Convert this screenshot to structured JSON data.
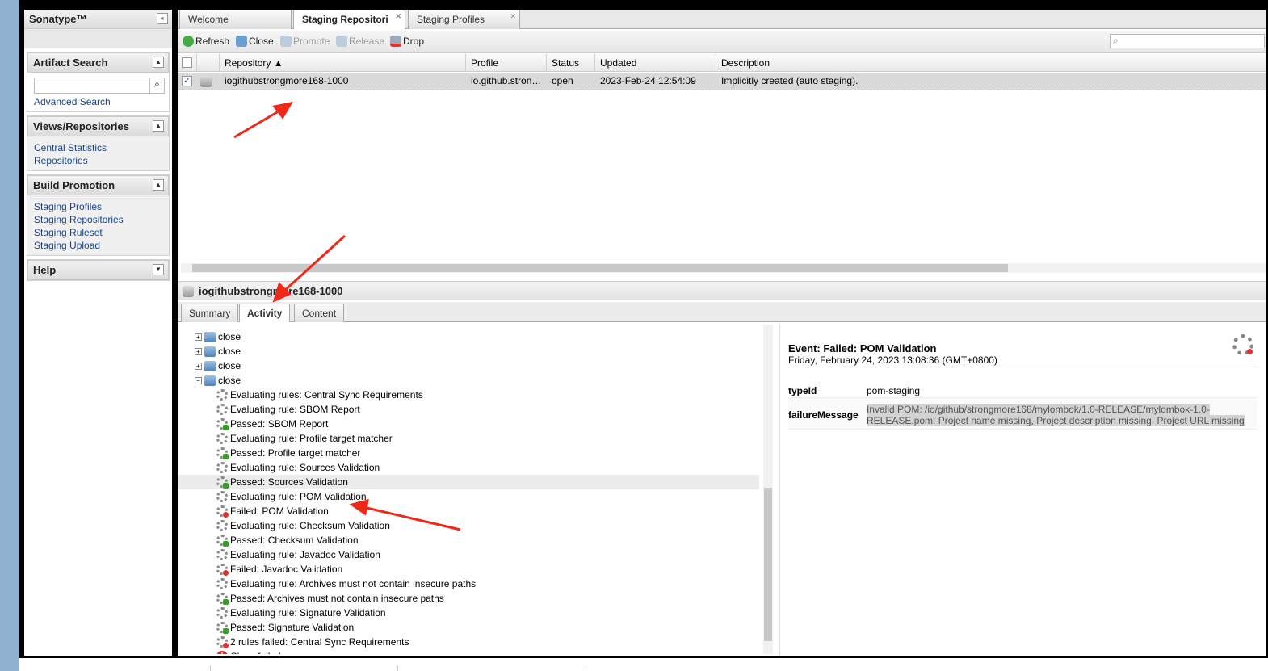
{
  "sidebar": {
    "title": "Sonatype™",
    "artifact_search": {
      "title": "Artifact Search",
      "placeholder": "",
      "advanced": "Advanced Search"
    },
    "views": {
      "title": "Views/Repositories",
      "items": [
        "Central Statistics",
        "Repositories"
      ]
    },
    "build": {
      "title": "Build Promotion",
      "items": [
        "Staging Profiles",
        "Staging Repositories",
        "Staging Ruleset",
        "Staging Upload"
      ]
    },
    "help": {
      "title": "Help"
    }
  },
  "tabs": [
    "Welcome",
    "Staging Repositori",
    "Staging Profiles"
  ],
  "toolbar": {
    "refresh": "Refresh",
    "close": "Close",
    "promote": "Promote",
    "release": "Release",
    "drop": "Drop"
  },
  "grid": {
    "columns": [
      "Repository ▲",
      "Profile",
      "Status",
      "Updated",
      "Description"
    ],
    "rows": [
      {
        "repository": "iogithubstrongmore168-1000",
        "profile": "io.github.stron…",
        "status": "open",
        "updated": "2023-Feb-24 12:54:09",
        "description": "Implicitly created (auto staging)."
      }
    ]
  },
  "detail": {
    "title": "iogithubstrongmore168-1000",
    "subtabs": [
      "Summary",
      "Activity",
      "Content"
    ],
    "tree": {
      "nodes": [
        "close",
        "close",
        "close",
        "close"
      ],
      "children": [
        {
          "t": "Evaluating rules: Central Sync Requirements",
          "s": "rules"
        },
        {
          "t": "Evaluating rule: SBOM Report",
          "s": "eval"
        },
        {
          "t": "Passed: SBOM Report",
          "s": "ok"
        },
        {
          "t": "Evaluating rule: Profile target matcher",
          "s": "eval"
        },
        {
          "t": "Passed: Profile target matcher",
          "s": "ok"
        },
        {
          "t": "Evaluating rule: Sources Validation",
          "s": "eval"
        },
        {
          "t": "Passed: Sources Validation",
          "s": "ok"
        },
        {
          "t": "Evaluating rule: POM Validation",
          "s": "eval"
        },
        {
          "t": "Failed: POM Validation",
          "s": "fail"
        },
        {
          "t": "Evaluating rule: Checksum Validation",
          "s": "eval"
        },
        {
          "t": "Passed: Checksum Validation",
          "s": "ok"
        },
        {
          "t": "Evaluating rule: Javadoc Validation",
          "s": "eval"
        },
        {
          "t": "Failed: Javadoc Validation",
          "s": "fail"
        },
        {
          "t": "Evaluating rule: Archives must not contain insecure paths",
          "s": "eval"
        },
        {
          "t": "Passed: Archives must not contain insecure paths",
          "s": "ok"
        },
        {
          "t": "Evaluating rule: Signature Validation",
          "s": "eval"
        },
        {
          "t": "Passed: Signature Validation",
          "s": "ok"
        },
        {
          "t": "2 rules failed: Central Sync Requirements",
          "s": "rulesfail"
        },
        {
          "t": "Close failed",
          "s": "error"
        }
      ]
    },
    "event": {
      "title": "Event: Failed: POM Validation",
      "date": "Friday, February 24, 2023 13:08:36 (GMT+0800)",
      "props": [
        {
          "k": "typeId",
          "v": "pom-staging"
        },
        {
          "k": "failureMessage",
          "v": "Invalid POM: /io/github/strongmore168/mylombok/1.0-RELEASE/mylombok-1.0-RELEASE.pom: Project name missing, Project description missing, Project URL missing"
        }
      ]
    }
  },
  "colors": {
    "link": "#15428b",
    "annotation": "#f02818"
  }
}
